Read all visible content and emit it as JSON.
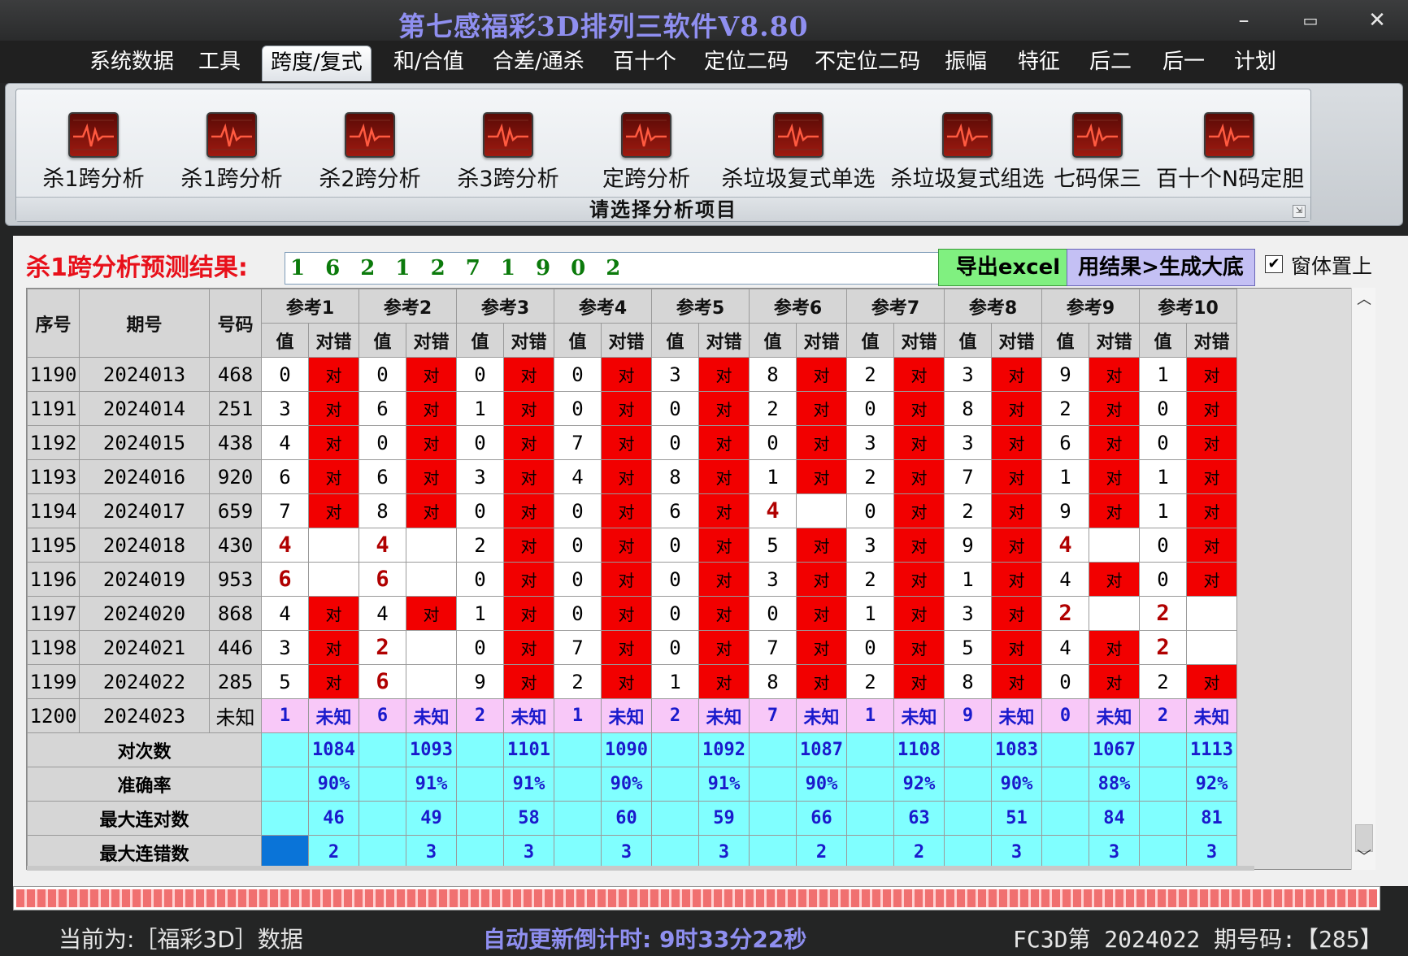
{
  "window": {
    "title": "第七感福彩3D排列三软件V8.80",
    "controls": {
      "minimize": "–",
      "maximize": "▭",
      "close": "✕"
    }
  },
  "menu": [
    {
      "label": "系统数据",
      "active": false
    },
    {
      "label": "工具",
      "active": false
    },
    {
      "label": "跨度/复式",
      "active": true
    },
    {
      "label": "和/合值",
      "active": false
    },
    {
      "label": "合差/通杀",
      "active": false
    },
    {
      "label": "百十个",
      "active": false
    },
    {
      "label": "定位二码",
      "active": false
    },
    {
      "label": "不定位二码",
      "active": false
    },
    {
      "label": "振幅",
      "active": false
    },
    {
      "label": "特征",
      "active": false
    },
    {
      "label": "后二",
      "active": false
    },
    {
      "label": "后一",
      "active": false
    },
    {
      "label": "计划",
      "active": false
    }
  ],
  "ribbon": {
    "buttons": [
      {
        "label": "杀1跨分析",
        "icon": "heartbeat-chart-icon"
      },
      {
        "label": "杀1跨分析",
        "icon": "heartbeat-chart-icon"
      },
      {
        "label": "杀2跨分析",
        "icon": "heartbeat-chart-icon"
      },
      {
        "label": "杀3跨分析",
        "icon": "heartbeat-chart-icon"
      },
      {
        "label": "定跨分析",
        "icon": "heartbeat-chart-icon"
      },
      {
        "label": "杀垃圾复式单选",
        "icon": "heartbeat-chart-icon"
      },
      {
        "label": "杀垃圾复式组选",
        "icon": "heartbeat-chart-icon"
      },
      {
        "label": "七码保三",
        "icon": "heartbeat-chart-icon"
      },
      {
        "label": "百十个N码定胆",
        "icon": "heartbeat-chart-icon"
      }
    ],
    "group_label": "请选择分析项目",
    "launcher": "⇲"
  },
  "prediction": {
    "label": "杀1跨分析预测结果:",
    "value": "1 6 2 1 2 7 1 9 0 2",
    "export_button": "导出excel",
    "generate_button": "用结果>生成大底",
    "on_top_checkbox": {
      "label": "窗体置上",
      "checked": true,
      "mark": "✔"
    }
  },
  "table": {
    "headers": {
      "seq": "序号",
      "issue": "期号",
      "number": "号码",
      "refs": [
        "参考1",
        "参考2",
        "参考3",
        "参考4",
        "参考5",
        "参考6",
        "参考7",
        "参考8",
        "参考9",
        "参考10"
      ],
      "sub_value": "值",
      "sub_result": "对错"
    },
    "result_hit": "对",
    "result_unknown": "未知",
    "rows": [
      {
        "seq": "1190",
        "issue": "2024013",
        "number": "468",
        "values": [
          0,
          0,
          0,
          0,
          3,
          8,
          2,
          3,
          9,
          1
        ],
        "hits": [
          1,
          1,
          1,
          1,
          1,
          1,
          1,
          1,
          1,
          1
        ]
      },
      {
        "seq": "1191",
        "issue": "2024014",
        "number": "251",
        "values": [
          3,
          6,
          1,
          0,
          0,
          2,
          0,
          8,
          2,
          0
        ],
        "hits": [
          1,
          1,
          1,
          1,
          1,
          1,
          1,
          1,
          1,
          1
        ]
      },
      {
        "seq": "1192",
        "issue": "2024015",
        "number": "438",
        "values": [
          4,
          0,
          0,
          7,
          0,
          0,
          3,
          3,
          6,
          0
        ],
        "hits": [
          1,
          1,
          1,
          1,
          1,
          1,
          1,
          1,
          1,
          1
        ]
      },
      {
        "seq": "1193",
        "issue": "2024016",
        "number": "920",
        "values": [
          6,
          6,
          3,
          4,
          8,
          1,
          2,
          7,
          1,
          1
        ],
        "hits": [
          1,
          1,
          1,
          1,
          1,
          1,
          1,
          1,
          1,
          1
        ]
      },
      {
        "seq": "1194",
        "issue": "2024017",
        "number": "659",
        "values": [
          7,
          8,
          0,
          0,
          6,
          4,
          0,
          2,
          9,
          1
        ],
        "hits": [
          1,
          1,
          1,
          1,
          1,
          0,
          1,
          1,
          1,
          1
        ]
      },
      {
        "seq": "1195",
        "issue": "2024018",
        "number": "430",
        "values": [
          4,
          4,
          2,
          0,
          0,
          5,
          3,
          9,
          4,
          0
        ],
        "hits": [
          0,
          0,
          1,
          1,
          1,
          1,
          1,
          1,
          0,
          1
        ]
      },
      {
        "seq": "1196",
        "issue": "2024019",
        "number": "953",
        "values": [
          6,
          6,
          0,
          0,
          0,
          3,
          2,
          1,
          4,
          0
        ],
        "hits": [
          0,
          0,
          1,
          1,
          1,
          1,
          1,
          1,
          1,
          1
        ]
      },
      {
        "seq": "1197",
        "issue": "2024020",
        "number": "868",
        "values": [
          4,
          4,
          1,
          0,
          0,
          0,
          1,
          3,
          2,
          2
        ],
        "hits": [
          1,
          1,
          1,
          1,
          1,
          1,
          1,
          1,
          0,
          0
        ]
      },
      {
        "seq": "1198",
        "issue": "2024021",
        "number": "446",
        "values": [
          3,
          2,
          0,
          7,
          0,
          7,
          0,
          5,
          4,
          2
        ],
        "hits": [
          1,
          0,
          1,
          1,
          1,
          1,
          1,
          1,
          1,
          0
        ]
      },
      {
        "seq": "1199",
        "issue": "2024022",
        "number": "285",
        "values": [
          5,
          6,
          9,
          2,
          1,
          8,
          2,
          8,
          0,
          2
        ],
        "hits": [
          1,
          0,
          1,
          1,
          1,
          1,
          1,
          1,
          1,
          1
        ]
      }
    ],
    "prediction_row": {
      "seq": "1200",
      "issue": "2024023",
      "number": "未知",
      "values": [
        1,
        6,
        2,
        1,
        2,
        7,
        1,
        9,
        0,
        2
      ]
    },
    "stats": [
      {
        "label": "对次数",
        "values": [
          "1084",
          "1093",
          "1101",
          "1090",
          "1092",
          "1087",
          "1108",
          "1083",
          "1067",
          "1113"
        ]
      },
      {
        "label": "准确率",
        "values": [
          "90%",
          "91%",
          "91%",
          "90%",
          "91%",
          "90%",
          "92%",
          "90%",
          "88%",
          "92%"
        ]
      },
      {
        "label": "最大连对数",
        "values": [
          "46",
          "49",
          "58",
          "60",
          "59",
          "66",
          "63",
          "51",
          "84",
          "81"
        ]
      },
      {
        "label": "最大连错数",
        "values": [
          "2",
          "3",
          "3",
          "3",
          "3",
          "2",
          "2",
          "3",
          "3",
          "3"
        ]
      }
    ]
  },
  "scrollbar": {
    "up": "︿",
    "down": "﹀"
  },
  "progress": {
    "fraction": 1.0
  },
  "status": {
    "left": "当前为:［福彩3D］数据",
    "middle": "自动更新倒计时:  9时33分22秒",
    "right": "FC3D第 2024022 期号码:【285】"
  },
  "colors": {
    "hit": "#f20000",
    "unknown_row": "#f8c8f8",
    "stats": "#80ffff",
    "miss_value": "#b00000",
    "title": "#8f8ff0",
    "prediction_label": "#e8101a"
  }
}
